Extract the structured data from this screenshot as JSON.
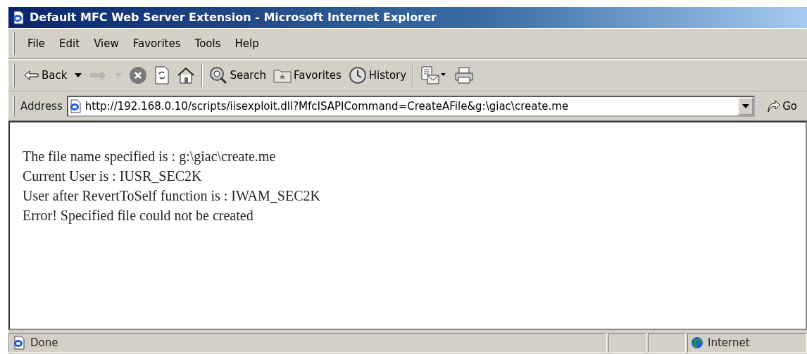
{
  "window": {
    "title": "Default MFC Web Server Extension - Microsoft Internet Explorer"
  },
  "menu": [
    {
      "label": "File"
    },
    {
      "label": "Edit"
    },
    {
      "label": "View"
    },
    {
      "label": "Favorites"
    },
    {
      "label": "Tools"
    },
    {
      "label": "Help"
    }
  ],
  "toolbar": [
    {
      "kind": "back",
      "label": "Back",
      "disabled": false
    },
    {
      "kind": "forward",
      "disabled": true
    },
    {
      "kind": "stop",
      "disabled": false
    },
    {
      "kind": "refresh",
      "disabled": false
    },
    {
      "kind": "home",
      "disabled": false
    },
    {
      "kind": "search",
      "label": "Search",
      "disabled": false
    },
    {
      "kind": "favorites",
      "label": "Favorites",
      "disabled": false
    },
    {
      "kind": "history",
      "label": "History",
      "disabled": false
    },
    {
      "kind": "mail",
      "disabled": false
    },
    {
      "kind": "print",
      "disabled": false
    }
  ],
  "address": {
    "label": "Address",
    "value": "http://192.168.0.10/scripts/iisexploit.dll?MfcISAPICommand=CreateAFile&g:\\giac\\create.me",
    "go": "Go"
  },
  "content": [
    "The file name specified is : g:\\giac\\create.me",
    "Current User is : IUSR_SEC2K",
    "User after RevertToSelf function is : IWAM_SEC2K",
    "Error! Specified file could not be created"
  ],
  "status_bar": {
    "text": "Done",
    "zone": "Internet"
  }
}
